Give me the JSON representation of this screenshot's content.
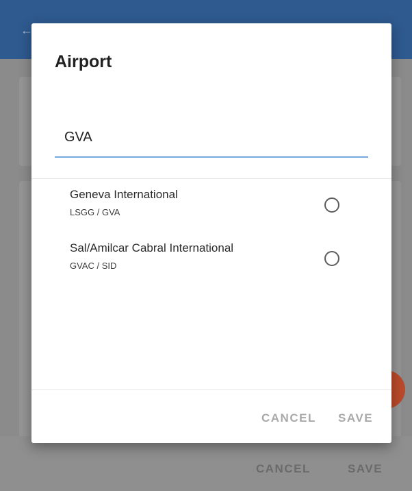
{
  "background": {
    "footer": {
      "cancel_label": "CANCEL",
      "save_label": "SAVE"
    }
  },
  "dialog": {
    "title": "Airport",
    "search": {
      "value": "GVA"
    },
    "results": [
      {
        "name": "Geneva International",
        "code": "LSGG / GVA",
        "selected": false
      },
      {
        "name": "Sal/Amilcar Cabral International",
        "code": "GVAC / SID",
        "selected": false
      }
    ],
    "actions": {
      "cancel_label": "CANCEL",
      "save_label": "SAVE"
    }
  },
  "colors": {
    "appbar": "#2e5a8f",
    "accent_underline": "#74a9e0",
    "fab": "#b94a2a"
  }
}
